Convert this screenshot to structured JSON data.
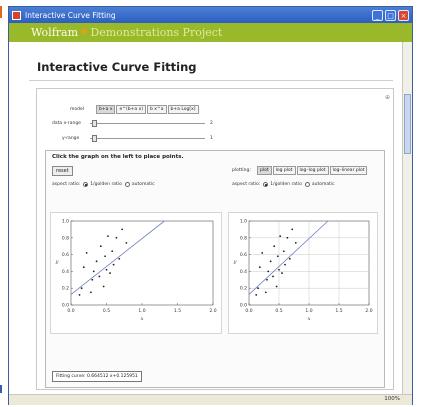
{
  "window": {
    "title": "Interactive Curve Fitting",
    "minimize": "_",
    "maximize": "□",
    "close": "×"
  },
  "banner": {
    "brand": "Wolfram",
    "star": "✸",
    "project": "Demonstrations Project"
  },
  "page_title": "Interactive Curve Fitting",
  "controls": {
    "model_label": "model",
    "model_options": [
      "b+a x",
      "e^(b+a x)",
      "b x^a",
      "b+a Log[x]"
    ],
    "model_selected": 0,
    "data_xrange_label": "data x-range",
    "data_xrange_value": "2",
    "yrange_label": "y-range",
    "yrange_value": "1",
    "toggle_symbol": "⊕"
  },
  "panel": {
    "instruction": "Click the graph on the left to place points.",
    "reset_label": "reset",
    "aspect_label": "aspect ratio:",
    "aspect_opt1": "1/golden ratio",
    "aspect_opt2": "automatic",
    "plotting_label": "plotting:",
    "plot_options": [
      "plot",
      "log plot",
      "log–log plot",
      "log–linear plot"
    ],
    "plot_selected": 0
  },
  "left_plot": {
    "xticks": [
      "0.0",
      "0.5",
      "1.0",
      "1.5",
      "2.0"
    ],
    "yticks": [
      "0.0",
      "0.2",
      "0.4",
      "0.6",
      "0.8",
      "1.0"
    ],
    "xlabel": "x",
    "ylabel": "y"
  },
  "right_plot": {
    "xticks": [
      "0.0",
      "0.5",
      "1.0",
      "1.5",
      "2.0"
    ],
    "yticks": [
      "0.0",
      "0.2",
      "0.4",
      "0.6",
      "0.8",
      "1.0"
    ],
    "xlabel": "x",
    "ylabel": "y"
  },
  "points": [
    [
      0.12,
      0.12
    ],
    [
      0.15,
      0.2
    ],
    [
      0.18,
      0.45
    ],
    [
      0.22,
      0.62
    ],
    [
      0.28,
      0.15
    ],
    [
      0.3,
      0.3
    ],
    [
      0.32,
      0.4
    ],
    [
      0.36,
      0.52
    ],
    [
      0.4,
      0.34
    ],
    [
      0.42,
      0.7
    ],
    [
      0.46,
      0.22
    ],
    [
      0.48,
      0.58
    ],
    [
      0.5,
      0.42
    ],
    [
      0.52,
      0.82
    ],
    [
      0.55,
      0.38
    ],
    [
      0.58,
      0.64
    ],
    [
      0.6,
      0.48
    ],
    [
      0.64,
      0.8
    ],
    [
      0.68,
      0.55
    ],
    [
      0.72,
      0.9
    ],
    [
      0.78,
      0.74
    ]
  ],
  "fit": {
    "slope": 0.664512,
    "intercept": 0.125951
  },
  "fit_text": "Fitting curve: 0.664512 x+0.125951",
  "status": {
    "zoom": "100%"
  }
}
